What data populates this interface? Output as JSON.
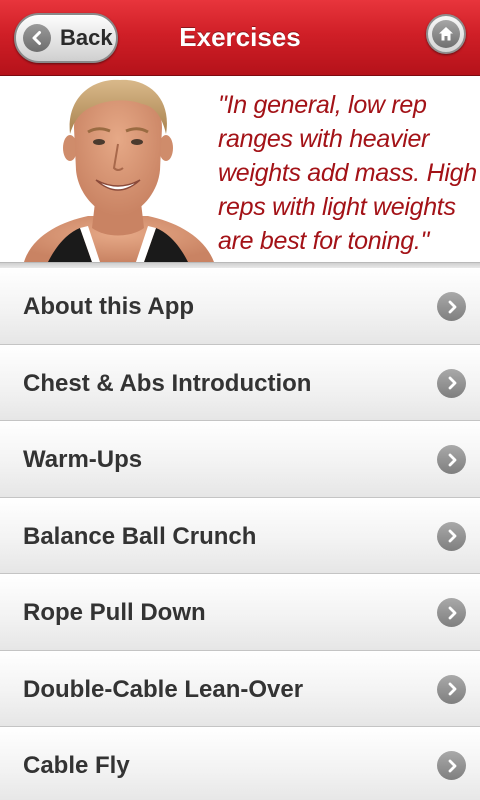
{
  "header": {
    "title": "Exercises",
    "back_label": "Back",
    "accent_color": "#d01f27"
  },
  "hero": {
    "quote": "\"In general, low rep ranges with heavier weights add mass. High reps with light weights are best for toning.\"",
    "quote_color": "#a31217"
  },
  "menu": {
    "items": [
      {
        "label": "About this App"
      },
      {
        "label": "Chest & Abs Introduction"
      },
      {
        "label": "Warm-Ups"
      },
      {
        "label": "Balance Ball Crunch"
      },
      {
        "label": "Rope Pull Down"
      },
      {
        "label": "Double-Cable Lean-Over"
      },
      {
        "label": "Cable Fly"
      }
    ]
  },
  "icons": {
    "back": "chevron-left-icon",
    "home": "home-icon",
    "row": "chevron-right-icon"
  }
}
